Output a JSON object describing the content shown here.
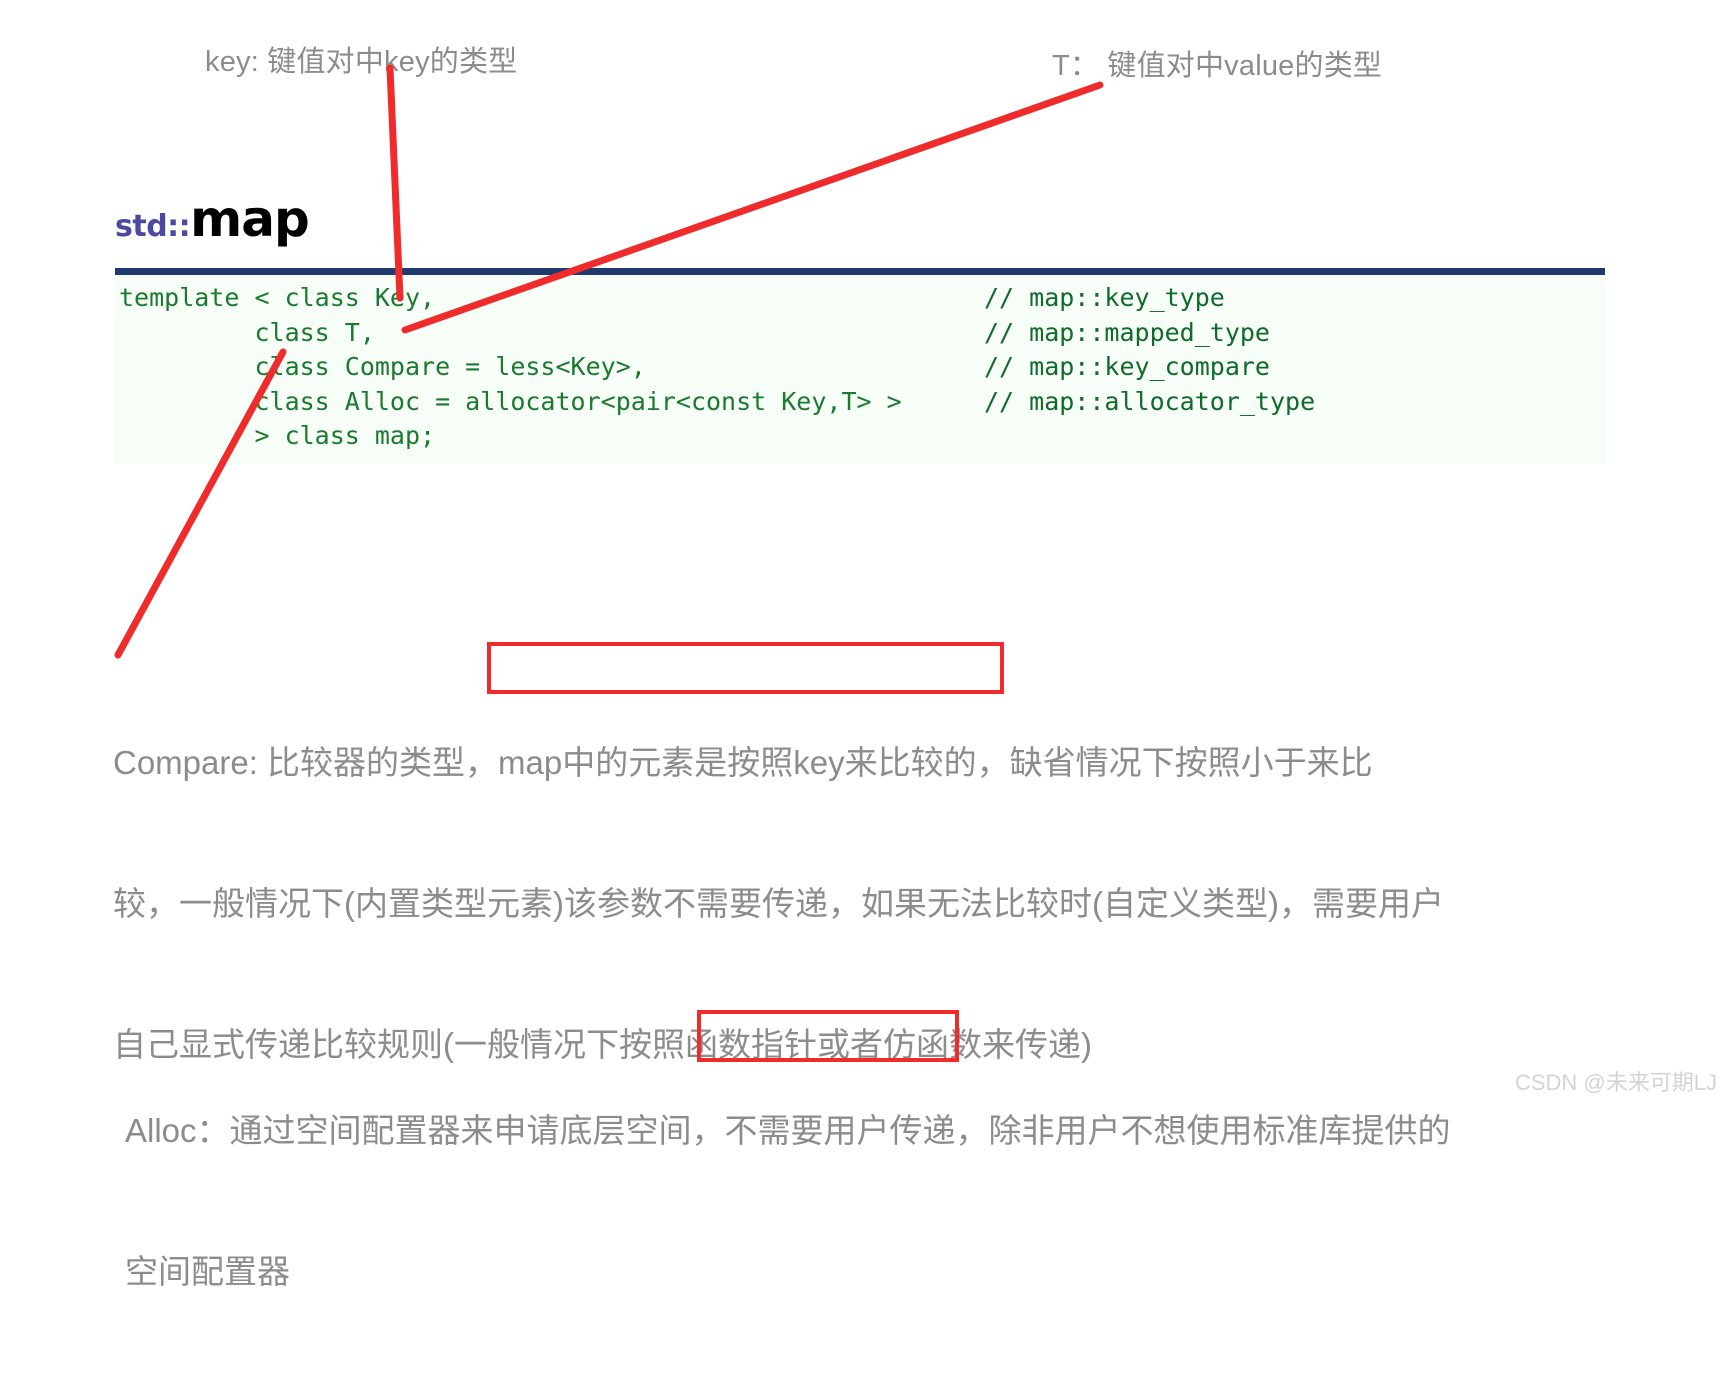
{
  "annotations": {
    "key_note": "key: 键值对中key的类型",
    "t_note": "T：  键值对中value的类型"
  },
  "title": {
    "namespace": "std::",
    "name": "map"
  },
  "code": {
    "lines": [
      {
        "code": "template < class Key,",
        "comment": "// map::key_type"
      },
      {
        "code": "         class T,",
        "comment": "// map::mapped_type"
      },
      {
        "code": "         class Compare = less<Key>,",
        "comment": "// map::key_compare"
      },
      {
        "code": "         class Alloc = allocator<pair<const Key,T> >",
        "comment": "// map::allocator_type"
      },
      {
        "code": "         > class map;",
        "comment": ""
      }
    ]
  },
  "compare_paragraph": {
    "line1": "Compare: 比较器的类型，map中的元素是按照key来比较的，缺省情况下按照小于来比",
    "line2": "较，一般情况下(内置类型元素)该参数不需要传递，如果无法比较时(自定义类型)，需要用户",
    "line3": "自己显式传递比较规则(一般情况下按照函数指针或者仿函数来传递)",
    "highlight": "map中的元素是按照key来比较的，"
  },
  "alloc_paragraph": {
    "line1": "Alloc：通过空间配置器来申请底层空间，不需要用户传递，除非用户不想使用标准库提供的",
    "line2": "空间配置器",
    "highlight": "不需要用户传递，"
  },
  "watermark": {
    "text": "CSDN @未来可期LJ"
  },
  "colors": {
    "annotation_text": "#8c8c8c",
    "code_text": "#1a7a2e",
    "code_background": "#f7fdf7",
    "code_top_border": "#1f3a6e",
    "title_namespace": "#4a4aa0",
    "title_name": "#000000",
    "marker_red": "#ef2b2b",
    "watermark": "#d4d4d4"
  }
}
